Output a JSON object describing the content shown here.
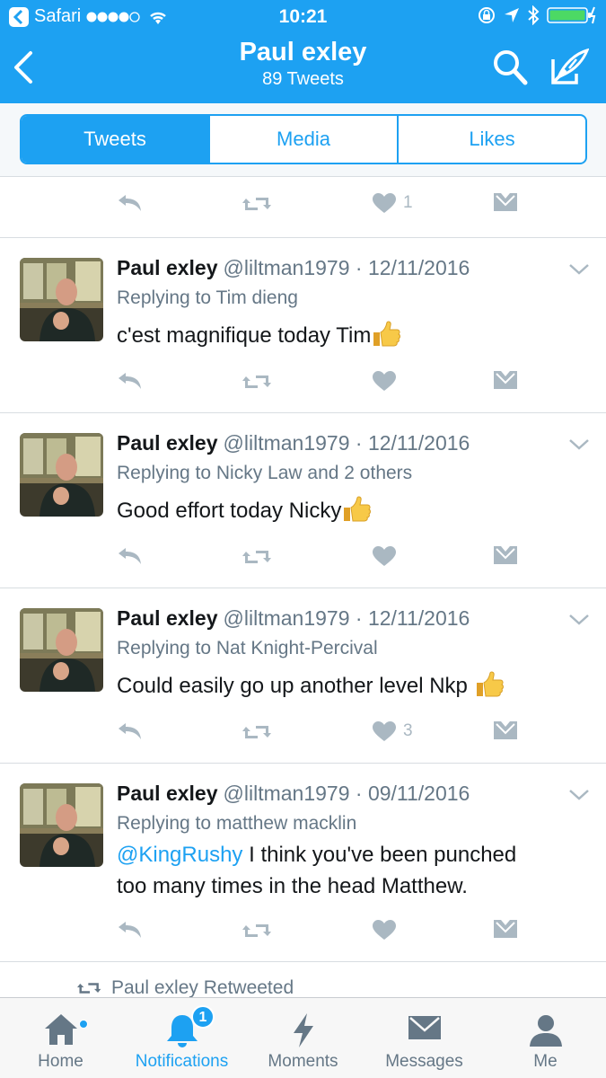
{
  "status_bar": {
    "carrier": "Safari",
    "time": "10:21"
  },
  "header": {
    "title": "Paul exley",
    "subtitle": "89 Tweets"
  },
  "tabs": [
    {
      "label": "Tweets",
      "active": true
    },
    {
      "label": "Media",
      "active": false
    },
    {
      "label": "Likes",
      "active": false
    }
  ],
  "top_partial": {
    "like_count": "1"
  },
  "tweets": [
    {
      "name": "Paul exley",
      "handle": "@liltman1979 · 12/11/2016",
      "reply": "Replying to Tim dieng",
      "text": "c'est magnifique today Tim",
      "like_count": ""
    },
    {
      "name": "Paul exley",
      "handle": "@liltman1979 · 12/11/2016",
      "reply": "Replying to Nicky Law and 2 others",
      "text": "Good effort today Nicky",
      "like_count": ""
    },
    {
      "name": "Paul exley",
      "handle": "@liltman1979 · 12/11/2016",
      "reply": "Replying to Nat Knight-Percival",
      "text": "Could easily go up another level Nkp ",
      "like_count": "3"
    },
    {
      "name": "Paul exley",
      "handle": "@liltman1979 · 09/11/2016",
      "reply": "Replying to matthew macklin",
      "mention": "@KingRushy",
      "text_line1": " I think you've been punched",
      "text_line2": "too many times in the head Matthew.",
      "like_count": ""
    }
  ],
  "retweeted_label": "Paul exley Retweeted",
  "tabbar": [
    {
      "label": "Home",
      "icon": "home-icon"
    },
    {
      "label": "Notifications",
      "icon": "bell-icon",
      "badge": "1"
    },
    {
      "label": "Moments",
      "icon": "lightning-icon"
    },
    {
      "label": "Messages",
      "icon": "envelope-icon"
    },
    {
      "label": "Me",
      "icon": "person-icon"
    }
  ],
  "colors": {
    "brand": "#1da1f2",
    "muted": "#657786",
    "icon_gray": "#aab8c2"
  }
}
